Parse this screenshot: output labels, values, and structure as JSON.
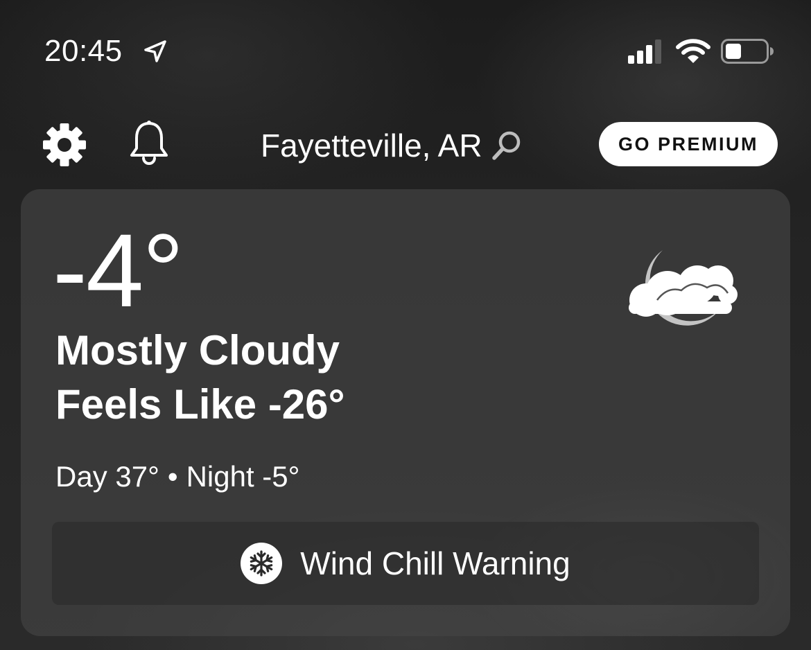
{
  "status_bar": {
    "time": "20:45",
    "icons": [
      "location-arrow-icon",
      "signal-icon",
      "wifi-icon",
      "battery-icon"
    ],
    "signal_bars": "3 of 4",
    "battery_level": 0.35
  },
  "nav": {
    "settings_icon": "gear-icon",
    "notifications_icon": "bell-icon",
    "location": "Fayetteville, AR",
    "search_icon": "search-icon",
    "premium_label": "GO PREMIUM"
  },
  "current": {
    "temperature": "-4°",
    "condition": "Mostly Cloudy",
    "feels_like": "Feels Like -26°",
    "day": "Day 37°",
    "separator": "•",
    "night": "Night -5°",
    "icon": "moon-cloud-icon"
  },
  "alert": {
    "icon": "snowflake-icon",
    "label": "Wind Chill Warning"
  },
  "colors": {
    "text": "#ffffff",
    "card": "#464646",
    "premium_bg": "#ffffff",
    "premium_text": "#111111",
    "icon_gray": "#cfcfcf"
  }
}
